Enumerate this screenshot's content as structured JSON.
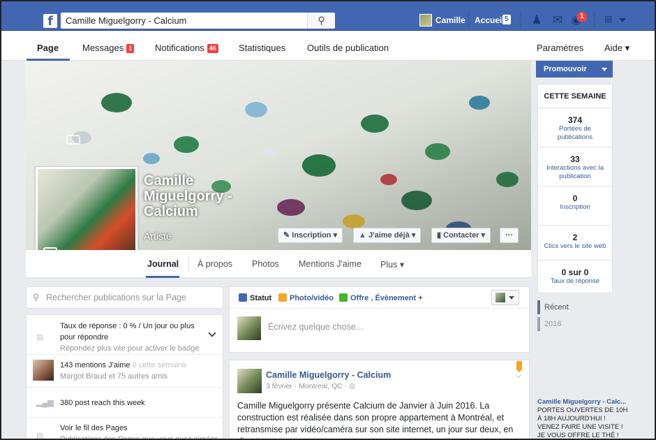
{
  "topbar": {
    "logo": "f",
    "search_value": "Camille Miguelgorry - Calcium",
    "search_icon": "magnifier-icon",
    "user_name": "Camille",
    "home_label": "Accueil",
    "home_count": "5",
    "notifications_count": "1",
    "color": "#4267b2"
  },
  "pagetabs": {
    "page": "Page",
    "messages": "Messages",
    "messages_count": "1",
    "notifications": "Notifications",
    "notifications_count": "46",
    "stats": "Statistiques",
    "publishing": "Outils de publication",
    "settings": "Paramètres",
    "help": "Aide"
  },
  "profile": {
    "name": "Camille Miguelgorry - Calcium",
    "category": "Artiste"
  },
  "cover_buttons": {
    "subscribe": "Inscription",
    "liked": "J'aime déjà",
    "contact": "Contacter",
    "more": "···"
  },
  "navtabs": {
    "timeline": "Journal",
    "about": "À propos",
    "photos": "Photos",
    "likes": "Mentions J'aime",
    "more": "Plus"
  },
  "sidebar": {
    "promote": "Promouvoir",
    "week_header": "CETTE SEMAINE",
    "stats": [
      {
        "num": "374",
        "label": "Portées de publications"
      },
      {
        "num": "33",
        "label": "Interactions avec la publication"
      },
      {
        "num": "0",
        "label": "Inscription"
      },
      {
        "num": "2",
        "label": "Clics vers le site web"
      },
      {
        "num": "0 sur 0",
        "label": "Taux de réponse"
      }
    ],
    "recent": "Récent",
    "year": "2016",
    "ad_title": "Camille Miguelgorry - Calc...",
    "ad_text": "PORTES OUVERTES DE 10H À 18H AUJOURD'HUI ! VENEZ FAIRE UNE VISITE ! JE VOUS OFFRE LE THÉ !"
  },
  "left": {
    "search_placeholder": "Rechercher publications sur la Page",
    "response_rate": "Taux de réponse : 0 % / Un jour ou plus pour répondre",
    "response_hint": "Répondez plus vite pour activer le badge",
    "likes": "143 mentions J'aime",
    "likes_week": "0 cette semaine",
    "likes_friends": "Margot Braud et 75 autres amis",
    "reach": "380 post reach this week",
    "feed_title": "Voir le fil des Pages",
    "feed_sub": "Publications des Pages que vous avez aimées"
  },
  "composer": {
    "status": "Statut",
    "photo": "Photo/vidéo",
    "offer": "Offre , Évènement +",
    "placeholder": "Écrivez quelque chose..."
  },
  "post": {
    "author": "Camille Miguelgorry - Calcium",
    "meta": "3 février · Montreal, QC · ◎",
    "text": "Camille Miguelgorry présente Calcium de Janvier à Juin 2016. La construction est réalisée dans son propre appartement à Montréal, et retransmise par vidéo/caméra sur son site internet, un jour sur deux, en direct."
  }
}
